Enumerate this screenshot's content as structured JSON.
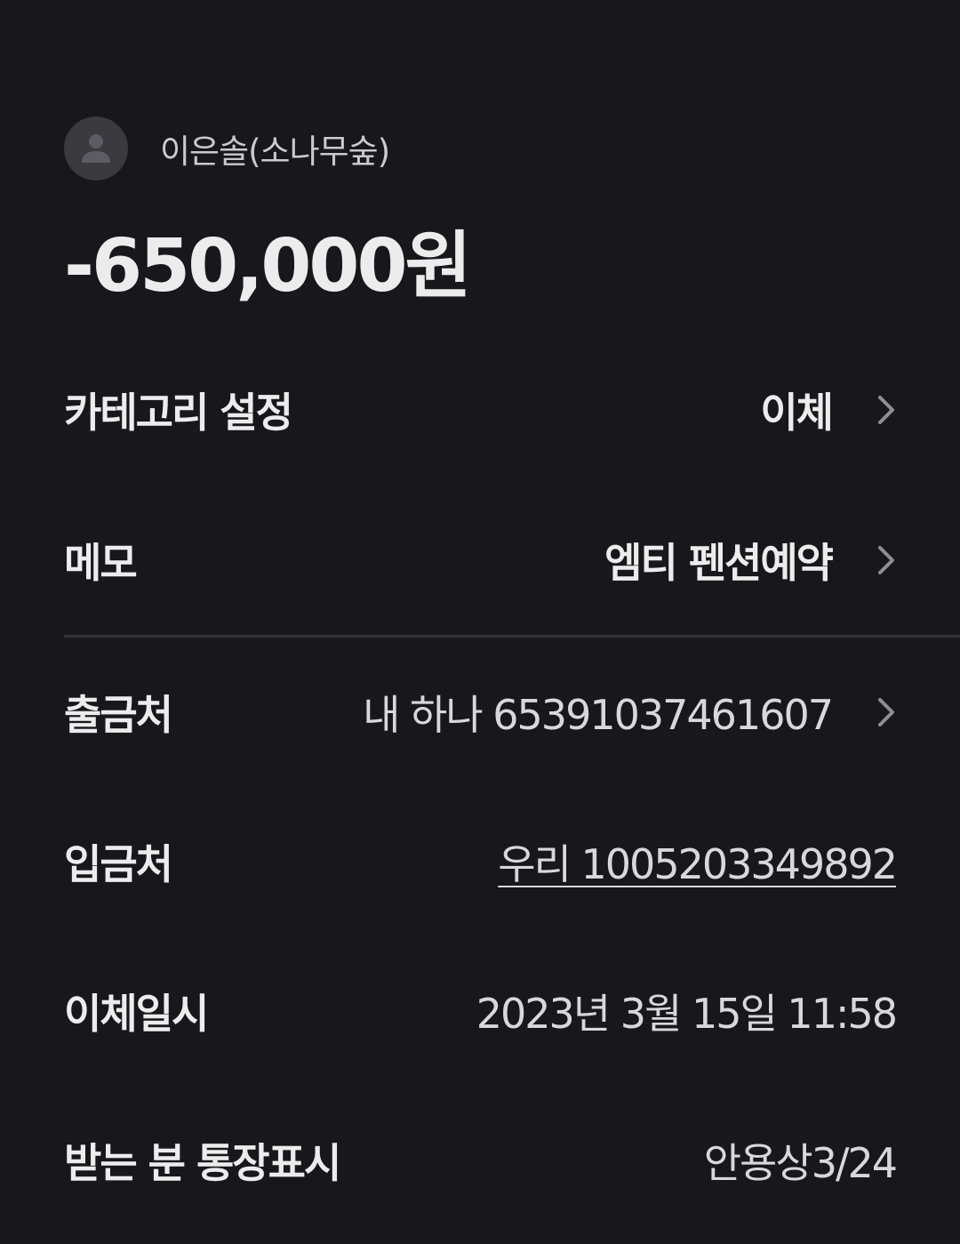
{
  "header": {
    "recipient_name": "이은솔(소나무숲)",
    "amount": "-650,000원",
    "avatar_icon": "person-icon"
  },
  "details": {
    "category": {
      "label": "카테고리 설정",
      "value": "이체"
    },
    "memo": {
      "label": "메모",
      "value": "엠티 펜션예약"
    },
    "from_account": {
      "label": "출금처",
      "value": "내 하나 65391037461607"
    },
    "to_account": {
      "label": "입금처",
      "value": "우리 1005203349892"
    },
    "transfer_datetime": {
      "label": "이체일시",
      "value": "2023년 3월 15일 11:58"
    },
    "recipient_display": {
      "label": "받는 분 통장표시",
      "value": "안용상3/24"
    }
  },
  "colors": {
    "background": "#18171c",
    "text": "#ececef",
    "muted": "#c9c9ce",
    "chevron": "#8e8e95",
    "divider": "#323238"
  },
  "icons": {
    "chevron": "chevron-right-icon"
  }
}
